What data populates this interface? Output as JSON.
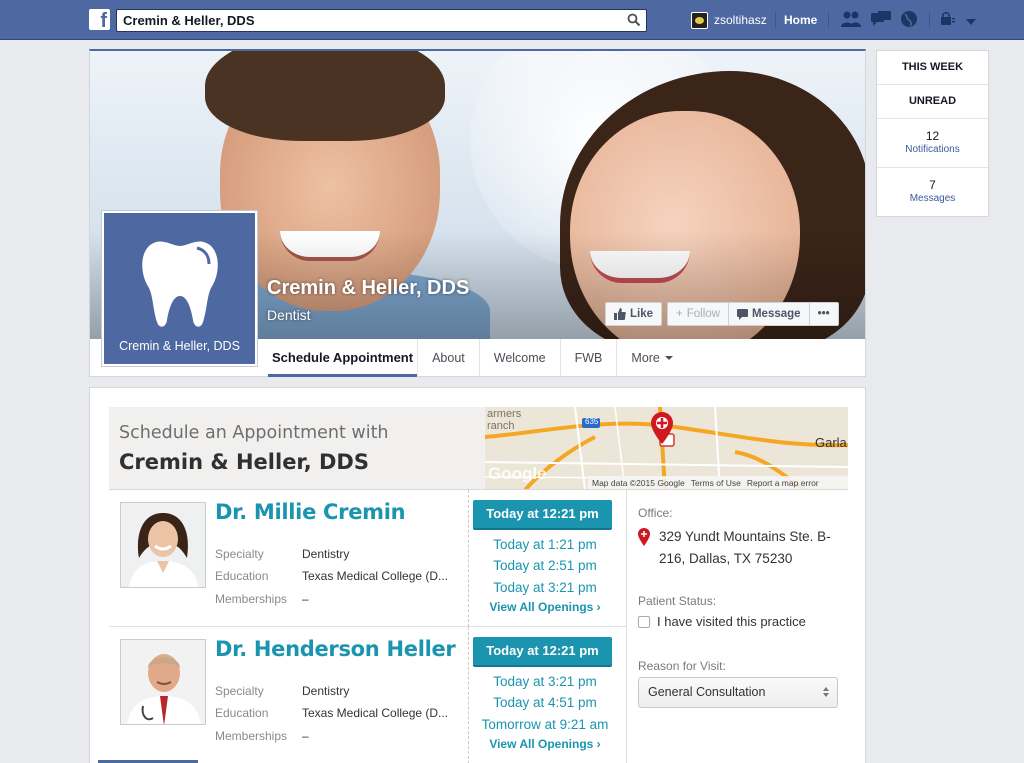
{
  "topbar": {
    "search_value": "Cremin & Heller, DDS",
    "user_name": "zsoltihasz",
    "home_label": "Home"
  },
  "page": {
    "name": "Cremin & Heller, DDS",
    "category": "Dentist",
    "profile_label": "Cremin & Heller, DDS",
    "actions": {
      "like": "Like",
      "follow": "Follow",
      "message": "Message",
      "more": "•••"
    },
    "tabs": [
      "Schedule Appointment",
      "About",
      "Welcome",
      "FWB",
      "More"
    ]
  },
  "sidebar": {
    "this_week": "THIS WEEK",
    "unread": "UNREAD",
    "notifications_count": "12",
    "notifications_label": "Notifications",
    "messages_count": "7",
    "messages_label": "Messages"
  },
  "scheduler": {
    "subtitle": "Schedule an Appointment with",
    "title": "Cremin & Heller, DDS",
    "map": {
      "labels": [
        "armers",
        "ranch",
        "Garla",
        "Google",
        "635"
      ],
      "footer": [
        "Map data ©2015 Google",
        "Terms of Use",
        "Report a map error"
      ]
    },
    "doctors": [
      {
        "name": "Dr. Millie Cremin",
        "specialty_label": "Specialty",
        "specialty": "Dentistry",
        "education_label": "Education",
        "education": "Texas Medical College (D...",
        "memberships_label": "Memberships",
        "memberships": "–",
        "primary_time": "Today at 12:21 pm",
        "times": [
          "Today at 1:21 pm",
          "Today at 2:51 pm",
          "Today at 3:21 pm"
        ],
        "view_all": "View All Openings ›"
      },
      {
        "name": "Dr. Henderson Heller",
        "specialty_label": "Specialty",
        "specialty": "Dentistry",
        "education_label": "Education",
        "education": "Texas Medical College (D...",
        "memberships_label": "Memberships",
        "memberships": "–",
        "primary_time": "Today at 12:21 pm",
        "times": [
          "Today at 3:21 pm",
          "Today at 4:51 pm",
          "Tomorrow at 9:21 am"
        ],
        "view_all": "View All Openings ›"
      }
    ],
    "office": {
      "label": "Office:",
      "address": "329 Yundt Mountains Ste. B-216, Dallas, TX 75230",
      "status_label": "Patient Status:",
      "visited_label": "I have visited this practice",
      "visited_checked": false,
      "reason_label": "Reason for Visit:",
      "reason_value": "General Consultation"
    }
  },
  "colors": {
    "facebook_blue": "#4e69a2",
    "accent_teal": "#1b94b0",
    "pin_red": "#d0181f"
  }
}
